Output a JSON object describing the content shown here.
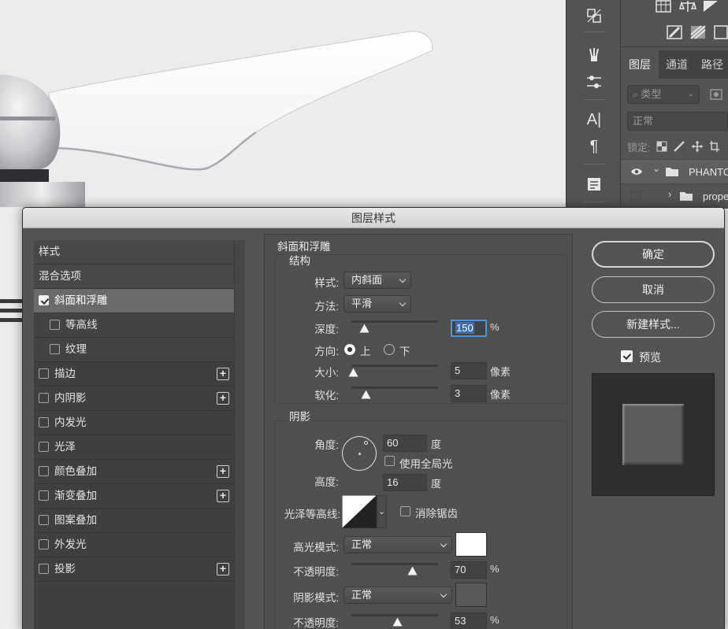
{
  "dialog": {
    "title": "图层样式",
    "styles": [
      {
        "label": "样式",
        "type": "header"
      },
      {
        "label": "混合选项",
        "type": "header"
      },
      {
        "label": "斜面和浮雕",
        "checked": true,
        "selected": true
      },
      {
        "label": "等高线",
        "checked": false,
        "sub": true
      },
      {
        "label": "纹理",
        "checked": false,
        "sub": true
      },
      {
        "label": "描边",
        "checked": false,
        "plus": true
      },
      {
        "label": "内阴影",
        "checked": false,
        "plus": true
      },
      {
        "label": "内发光",
        "checked": false
      },
      {
        "label": "光泽",
        "checked": false
      },
      {
        "label": "颜色叠加",
        "checked": false,
        "plus": true
      },
      {
        "label": "渐变叠加",
        "checked": false,
        "plus": true
      },
      {
        "label": "图案叠加",
        "checked": false
      },
      {
        "label": "外发光",
        "checked": false
      },
      {
        "label": "投影",
        "checked": false,
        "plus": true
      }
    ],
    "bevel": {
      "section_title": "斜面和浮雕",
      "structure_title": "结构",
      "style_label": "样式:",
      "style_value": "内斜面",
      "technique_label": "方法:",
      "technique_value": "平滑",
      "depth_label": "深度:",
      "depth_value": "150",
      "depth_unit": "%",
      "depth_slider": 0.15,
      "direction_label": "方向:",
      "direction_up": "上",
      "direction_down": "下",
      "direction_selected": "上",
      "size_label": "大小:",
      "size_value": "5",
      "size_unit": "像素",
      "size_slider": 0.02,
      "soften_label": "软化:",
      "soften_value": "3",
      "soften_unit": "像素",
      "soften_slider": 0.17
    },
    "shading": {
      "title": "阴影",
      "angle_label": "角度:",
      "angle_value": "60",
      "angle_unit": "度",
      "global_light_label": "使用全局光",
      "global_light_checked": false,
      "altitude_label": "高度:",
      "altitude_value": "16",
      "altitude_unit": "度",
      "gloss_label": "光泽等高线:",
      "antialias_label": "消除锯齿",
      "antialias_checked": false,
      "highlight_mode_label": "高光模式:",
      "highlight_mode_value": "正常",
      "highlight_color": "#ffffff",
      "highlight_opacity_label": "不透明度:",
      "highlight_opacity_value": "70",
      "highlight_opacity_unit": "%",
      "highlight_opacity_slider": 0.7,
      "shadow_mode_label": "阴影模式:",
      "shadow_mode_value": "正常",
      "shadow_color": "#5a5758",
      "shadow_opacity_label": "不透明度:",
      "shadow_opacity_value": "53",
      "shadow_opacity_unit": "%",
      "shadow_opacity_slider": 0.53
    },
    "buttons": {
      "ok": "确定",
      "cancel": "取消",
      "new_style": "新建样式...",
      "preview_label": "预览",
      "preview_checked": true
    }
  },
  "layers_panel": {
    "tabs": [
      "图层",
      "通道",
      "路径"
    ],
    "active_tab": "图层",
    "search_placeholder": "类型",
    "blend_mode": "正常",
    "lock_label": "锁定:",
    "layers": [
      {
        "name": "PHANTO",
        "visible": true,
        "expanded": true,
        "folder": true
      },
      {
        "name": "prope",
        "visible": false,
        "expanded": false,
        "folder": true
      }
    ]
  },
  "colors": {
    "panel_bg": "#535353",
    "focus_ring": "#4f94ce"
  }
}
